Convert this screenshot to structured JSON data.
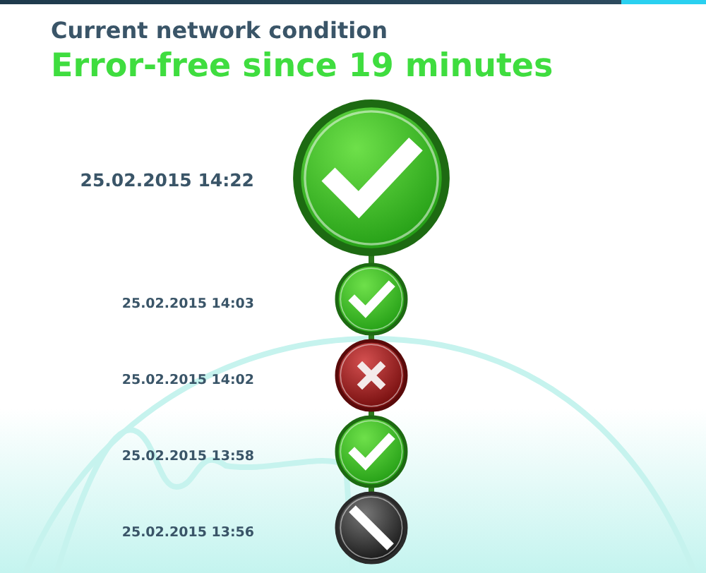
{
  "heading": "Current network condition",
  "status": "Error-free since 19 minutes",
  "current": {
    "time": "25.02.2015 14:22",
    "kind": "ok"
  },
  "history": [
    {
      "time": "25.02.2015 14:03",
      "kind": "ok"
    },
    {
      "time": "25.02.2015 14:02",
      "kind": "error"
    },
    {
      "time": "25.02.2015 13:58",
      "kind": "ok"
    },
    {
      "time": "25.02.2015 13:56",
      "kind": "unknown"
    }
  ]
}
